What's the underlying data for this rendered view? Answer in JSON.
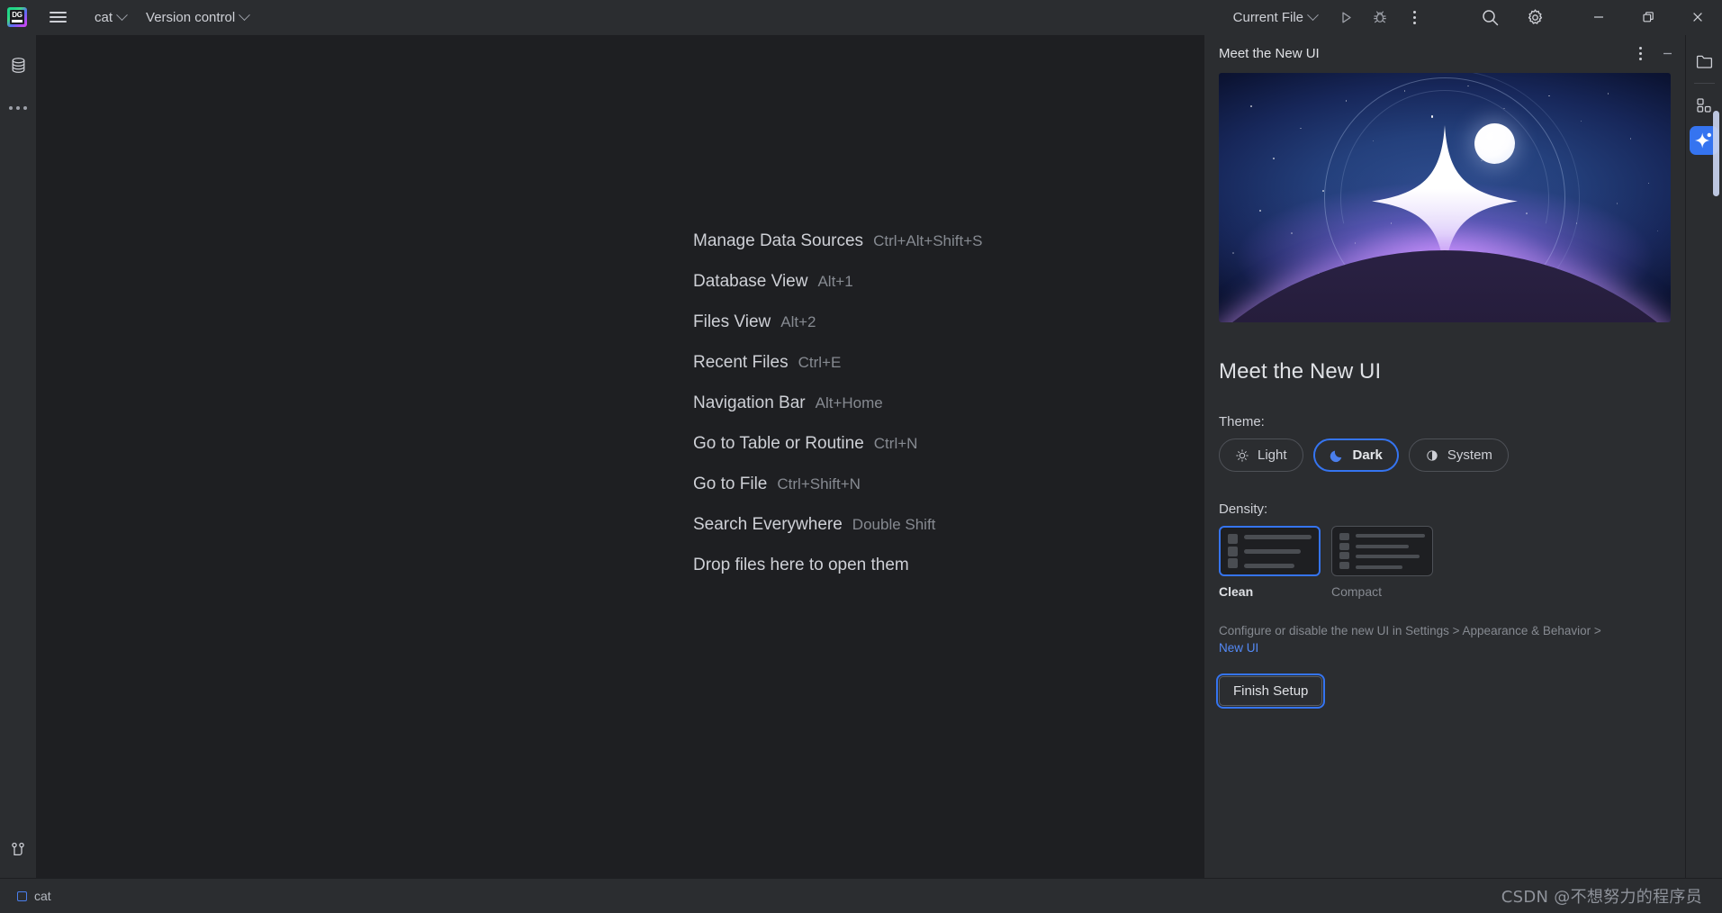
{
  "app": {
    "logo_text": "DG",
    "accent_blue": "#3574F0",
    "link_blue": "#548AF7",
    "panel_bg": "#2B2D30",
    "editor_bg": "#1E1F22"
  },
  "toolbar": {
    "menu_icon": "hamburger-icon",
    "project_name": "cat",
    "vcs_label": "Version control",
    "run_config": "Current File",
    "run_icon": "run-play-icon",
    "debug_icon": "debug-bug-icon",
    "more_icon": "more-vertical-icon",
    "search_icon": "search-icon",
    "settings_icon": "settings-gear-icon",
    "minimize_icon": "window-minimize-icon",
    "maximize_icon": "window-restore-icon",
    "close_icon": "window-close-icon"
  },
  "left_rail": {
    "database_icon": "database-icon",
    "more_icon": "more-horizontal-icon",
    "vcs_icon": "git-branch-icon"
  },
  "editor": {
    "shortcuts": [
      {
        "label": "Manage Data Sources",
        "key": "Ctrl+Alt+Shift+S"
      },
      {
        "label": "Database View",
        "key": "Alt+1"
      },
      {
        "label": "Files View",
        "key": "Alt+2"
      },
      {
        "label": "Recent Files",
        "key": "Ctrl+E"
      },
      {
        "label": "Navigation Bar",
        "key": "Alt+Home"
      },
      {
        "label": "Go to Table or Routine",
        "key": "Ctrl+N"
      },
      {
        "label": "Go to File",
        "key": "Ctrl+Shift+N"
      },
      {
        "label": "Search Everywhere",
        "key": "Double Shift"
      }
    ],
    "drop_hint": "Drop files here to open them"
  },
  "panel": {
    "title": "Meet the New UI",
    "options_icon": "more-vertical-icon",
    "hide_icon": "minimize-icon",
    "hero_alt": "new-ui-cosmic-banner",
    "heading": "Meet the New UI",
    "theme_label": "Theme:",
    "themes": [
      {
        "label": "Light",
        "icon": "sun-icon",
        "selected": false
      },
      {
        "label": "Dark",
        "icon": "moon-icon",
        "selected": true
      },
      {
        "label": "System",
        "icon": "half-circle-icon",
        "selected": false
      }
    ],
    "density_label": "Density:",
    "densities": [
      {
        "label": "Clean",
        "rows": 3,
        "selected": true
      },
      {
        "label": "Compact",
        "rows": 4,
        "selected": false
      }
    ],
    "hint_prefix": "Configure or disable the new UI in Settings > Appearance & Behavior > ",
    "hint_link": "New UI",
    "finish_label": "Finish Setup"
  },
  "right_rail": {
    "project_icon": "folder-icon",
    "plugins_icon": "grid-plugins-icon",
    "ai_icon": "ai-sparkle-icon"
  },
  "status": {
    "project_label": "cat",
    "project_icon": "project-square-icon",
    "watermark": "CSDN @不想努力的程序员"
  }
}
